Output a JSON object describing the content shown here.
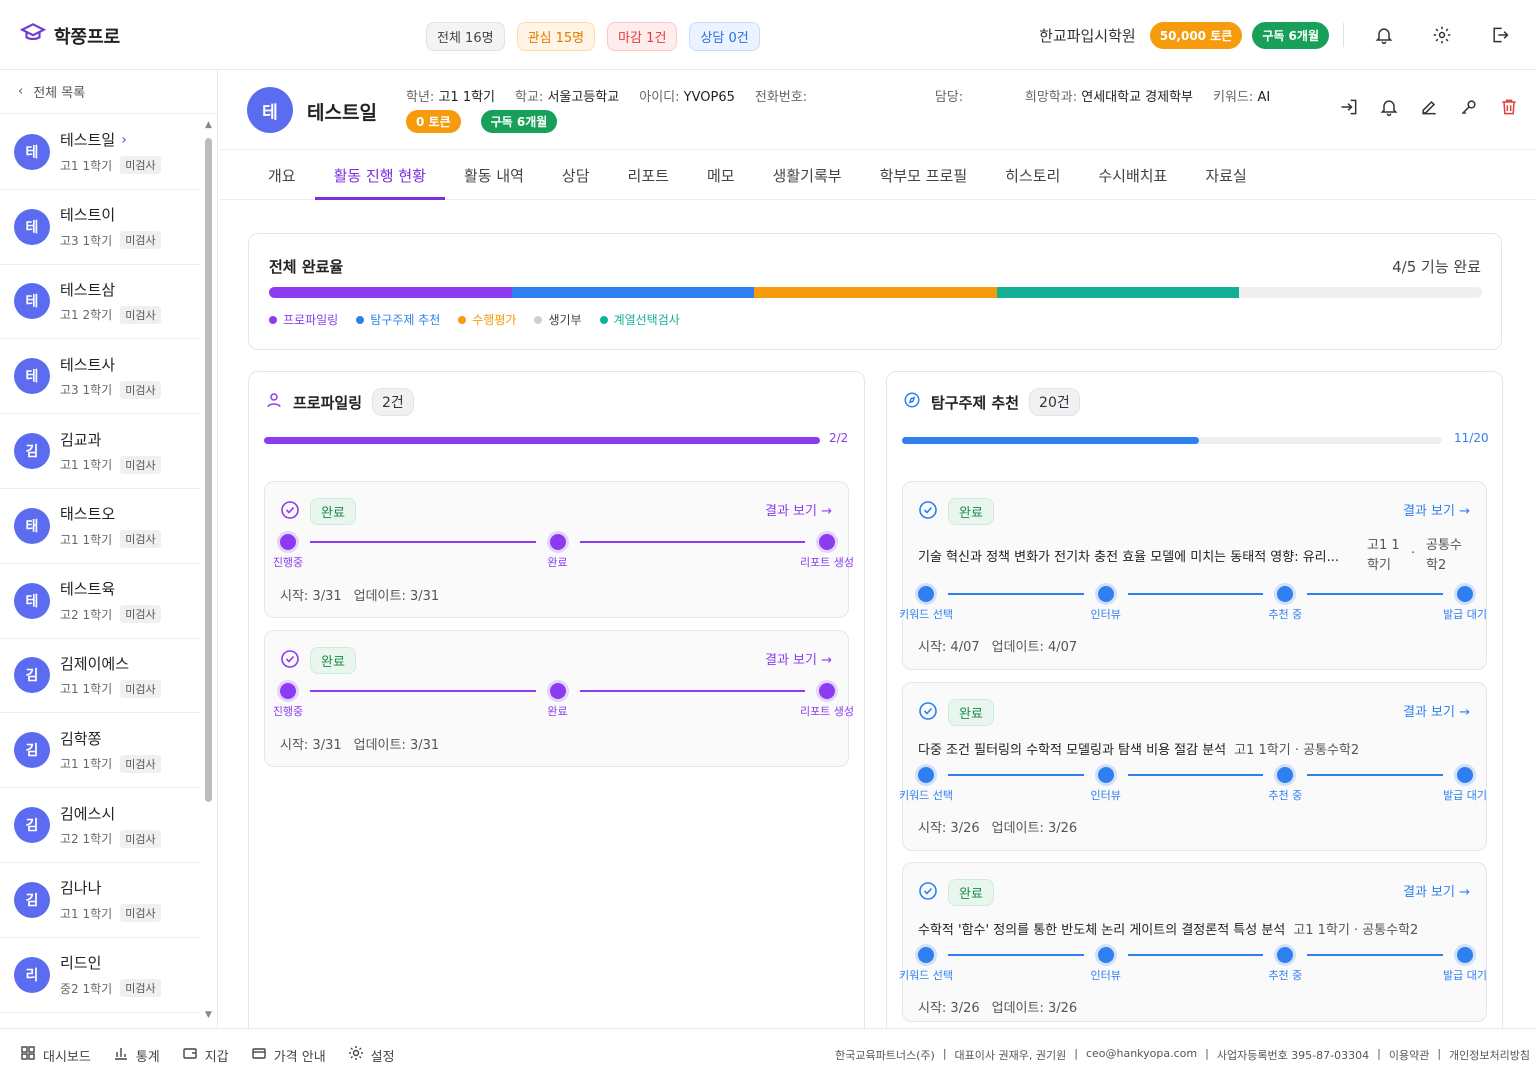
{
  "app": {
    "title": "학쫑프로"
  },
  "topbar": {
    "pills": [
      "전체 16명",
      "관심 15명",
      "마감 1건",
      "상담 0건"
    ],
    "academy": "한교파입시학원",
    "tokens": "50,000 토큰",
    "subscription": "구독 6개월"
  },
  "sidebar": {
    "back_label": "전체 목록",
    "students": [
      {
        "initial": "테",
        "name": "테스트일",
        "grade": "고1 1학기",
        "tag": "미검사",
        "selected": true
      },
      {
        "initial": "테",
        "name": "테스트이",
        "grade": "고3 1학기",
        "tag": "미검사"
      },
      {
        "initial": "테",
        "name": "테스트삼",
        "grade": "고1 2학기",
        "tag": "미검사"
      },
      {
        "initial": "테",
        "name": "테스트사",
        "grade": "고3 1학기",
        "tag": "미검사"
      },
      {
        "initial": "김",
        "name": "김교과",
        "grade": "고1 1학기",
        "tag": "미검사"
      },
      {
        "initial": "태",
        "name": "태스트오",
        "grade": "고1 1학기",
        "tag": "미검사"
      },
      {
        "initial": "테",
        "name": "테스트육",
        "grade": "고2 1학기",
        "tag": "미검사"
      },
      {
        "initial": "김",
        "name": "김제이에스",
        "grade": "고1 1학기",
        "tag": "미검사"
      },
      {
        "initial": "김",
        "name": "김학쫑",
        "grade": "고1 1학기",
        "tag": "미검사"
      },
      {
        "initial": "김",
        "name": "김에스시",
        "grade": "고2 1학기",
        "tag": "미검사"
      },
      {
        "initial": "김",
        "name": "김나나",
        "grade": "고1 1학기",
        "tag": "미검사"
      },
      {
        "initial": "리",
        "name": "리드인",
        "grade": "중2 1학기",
        "tag": "미검사"
      }
    ]
  },
  "profile": {
    "initial": "테",
    "name": "테스트일",
    "grade_label": "학년:",
    "grade": "고1 1학기",
    "school_label": "학교:",
    "school": "서울고등학교",
    "id_label": "아이디:",
    "id": "YVOP65",
    "phone_label": "전화번호:",
    "phone": "",
    "manager_label": "담당:",
    "manager": "",
    "dept_label": "희망학과:",
    "dept": "연세대학교 경제학부",
    "keyword_label": "키워드:",
    "keyword": "AI",
    "token_badge": "0 토큰",
    "sub_badge": "구독 6개월"
  },
  "tabs": [
    "개요",
    "활동 진행 현황",
    "활동 내역",
    "상담",
    "리포트",
    "메모",
    "생활기록부",
    "학부모 프로필",
    "히스토리",
    "수시배치표",
    "자료실"
  ],
  "active_tab": 1,
  "overall": {
    "title": "전체 완료율",
    "summary": "4/5 기능 완료",
    "segments": [
      {
        "name": "프로파일링",
        "color": "#8b3cf0",
        "done": true
      },
      {
        "name": "탐구주제 추천",
        "color": "#2f7ff0",
        "done": true
      },
      {
        "name": "수행평가",
        "color": "#f59b0c",
        "done": true
      },
      {
        "name": "생기부",
        "color": "#cfcfd6",
        "done": false
      },
      {
        "name": "계열선택검사",
        "color": "#14b096",
        "done": true
      }
    ]
  },
  "profiling": {
    "title": "프로파일링",
    "count": "2건",
    "progress_label": "2/2",
    "progress": 1.0,
    "items": [
      {
        "status": "완료",
        "result": "결과 보기 →",
        "steps": [
          "진행중",
          "완료",
          "리포트 생성"
        ],
        "start": "시작: 3/31",
        "update": "업데이트: 3/31"
      },
      {
        "status": "완료",
        "result": "결과 보기 →",
        "steps": [
          "진행중",
          "완료",
          "리포트 생성"
        ],
        "start": "시작: 3/31",
        "update": "업데이트: 3/31"
      }
    ]
  },
  "topics": {
    "title": "탐구주제 추천",
    "count": "20건",
    "progress_label": "11/20",
    "progress": 0.55,
    "items": [
      {
        "status": "완료",
        "result": "결과 보기 →",
        "topic": "기술 혁신과 정책 변화가 전기차 충전 효율 모델에 미치는 동태적 영향: 유리...",
        "grade_line1": "고1 1",
        "grade_line2": "학기",
        "sep": "·",
        "subject_line1": "공통수",
        "subject_line2": "학2",
        "steps": [
          "키워드 선택",
          "인터뷰",
          "추천 중",
          "발급 대기"
        ],
        "start": "시작: 4/07",
        "update": "업데이트: 4/07"
      },
      {
        "status": "완료",
        "result": "결과 보기 →",
        "topic": "다중 조건 필터링의 수학적 모델링과 탐색 비용 절감 분석",
        "meta": "고1 1학기 · 공통수학2",
        "steps": [
          "키워드 선택",
          "인터뷰",
          "추천 중",
          "발급 대기"
        ],
        "start": "시작: 3/26",
        "update": "업데이트: 3/26"
      },
      {
        "status": "완료",
        "result": "결과 보기 →",
        "topic": "수학적 '함수' 정의를 통한 반도체 논리 게이트의 결정론적 특성 분석",
        "meta": "고1 1학기 · 공통수학2",
        "steps": [
          "키워드 선택",
          "인터뷰",
          "추천 중",
          "발급 대기"
        ],
        "start": "시작: 3/26",
        "update": "업데이트: 3/26"
      }
    ]
  },
  "footer": {
    "nav": [
      "대시보드",
      "통계",
      "지갑",
      "가격 안내",
      "설정"
    ],
    "info": [
      "한국교육파트너스(주)",
      "|",
      "대표이사 권재우, 권기원",
      "|",
      "ceo@hankyopa.com",
      "|",
      "사업자등록번호 395-87-03304",
      "|",
      "이용약관",
      "|",
      "개인정보처리방침"
    ]
  },
  "colors": {
    "purple": "#8b3cf0",
    "blue": "#2f7ff0",
    "orange": "#f59b0c",
    "teal": "#14b096",
    "green": "#18a05a",
    "red": "#e03e3e"
  }
}
